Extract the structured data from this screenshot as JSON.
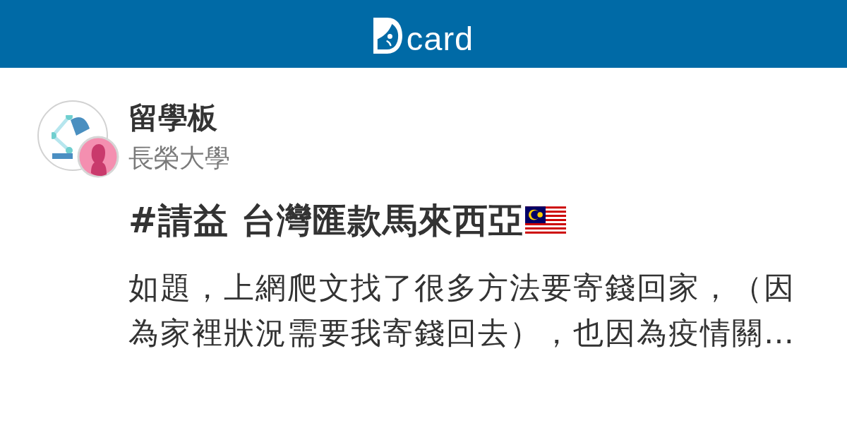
{
  "header": {
    "logo_text": "card"
  },
  "post": {
    "board": "留學板",
    "school": "長榮大學",
    "title": "#請益 台灣匯款馬來西亞",
    "excerpt": "如題，上網爬文找了很多方法要寄錢回家，（因為家裡狀況需要我寄錢回去），也因為疫情關…"
  }
}
